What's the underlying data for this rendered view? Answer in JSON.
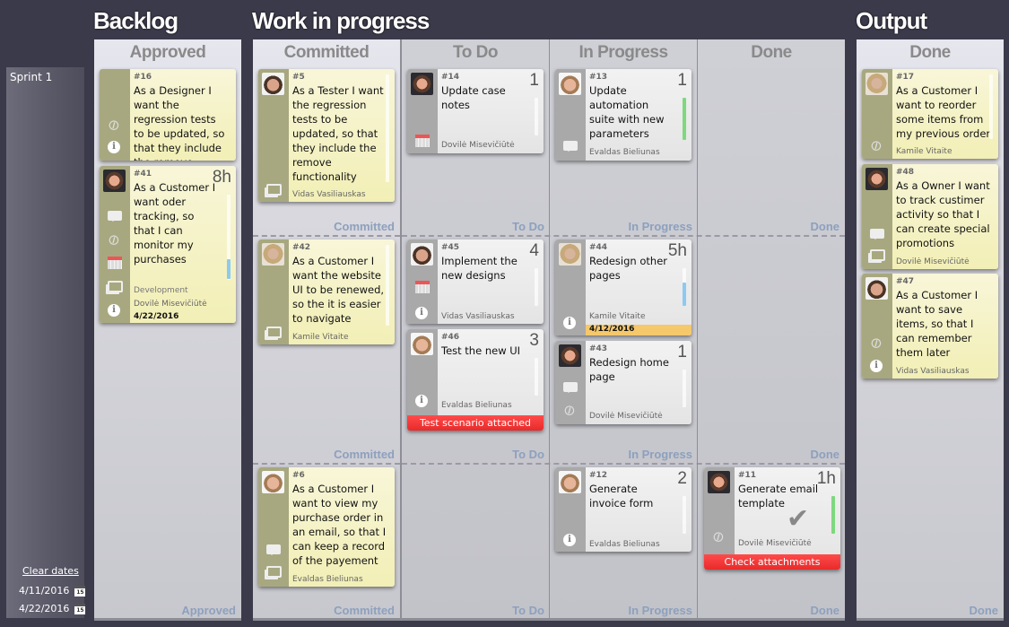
{
  "groups": {
    "backlog": "Backlog",
    "wip": "Work in progress",
    "output": "Output"
  },
  "sidebar": {
    "sprint": "Sprint 1",
    "clear_dates": "Clear dates",
    "dates": [
      "4/11/2016",
      "4/22/2016"
    ],
    "calendar_day": "15"
  },
  "columns": {
    "approved": "Approved",
    "committed": "Committed",
    "todo": "To Do",
    "inprogress": "In Progress",
    "done": "Done",
    "output_done": "Done"
  },
  "cards": {
    "c16": {
      "num": "#16",
      "title": "As a Designer I want the regression tests to be updated, so that they include the remove functionality"
    },
    "c41": {
      "num": "#41",
      "title": "As a Customer I want oder tracking, so that I can monitor my purchases",
      "estimate": "8h",
      "meta": "Development",
      "owner": "Dovilė Misevičiūtė",
      "due": "4/22/2016"
    },
    "c5": {
      "num": "#5",
      "title": "As a Tester I want the regression tests to be updated, so that they include the remove functionality",
      "owner": "Vidas Vasiliauskas"
    },
    "c42": {
      "num": "#42",
      "title": "As a Customer I want the website UI to be renewed, so the it is easier to navigate",
      "owner": "Kamile  Vitaite"
    },
    "c6": {
      "num": "#6",
      "title": "As a Customer I want to view my purchase order in an email, so that I can keep a record of the payement",
      "owner": "Evaldas Bieliunas"
    },
    "c14": {
      "num": "#14",
      "title": "Update case notes",
      "estimate": "1",
      "owner": "Dovilė Misevičiūtė"
    },
    "c45": {
      "num": "#45",
      "title": "Implement the new designs",
      "estimate": "4",
      "owner": "Vidas Vasiliauskas"
    },
    "c46": {
      "num": "#46",
      "title": "Test the new UI",
      "estimate": "3",
      "owner": "Evaldas Bieliunas",
      "banner": "Test scenario attached"
    },
    "c13": {
      "num": "#13",
      "title": "Update automation suite with new parameters",
      "estimate": "1",
      "owner": "Evaldas Bieliunas"
    },
    "c44": {
      "num": "#44",
      "title": "Redesign other pages",
      "estimate": "5h",
      "owner": "Kamile  Vitaite",
      "due": "4/12/2016"
    },
    "c43": {
      "num": "#43",
      "title": "Redesign home page",
      "estimate": "1",
      "owner": "Dovilė Misevičiūtė"
    },
    "c12": {
      "num": "#12",
      "title": "Generate invoice form",
      "estimate": "2",
      "owner": "Evaldas Bieliunas"
    },
    "c11": {
      "num": "#11",
      "title": "Generate email template",
      "estimate": "1h",
      "owner": "Dovilė Misevičiūtė",
      "banner": "Check attachments"
    },
    "c17": {
      "num": "#17",
      "title": "As a Customer I want to reorder some items from my previous order",
      "owner": "Kamile  Vitaite"
    },
    "c48": {
      "num": "#48",
      "title": "As a Owner I want to track custimer activity so that I can create special promotions",
      "owner": "Dovilė Misevičiūtė"
    },
    "c47": {
      "num": "#47",
      "title": "As a Customer I want to save items, so that I can remember them later",
      "owner": "Vidas Vasiliauskas"
    }
  },
  "colors": {
    "banner_red": "#f03a3a",
    "due_orange": "#f5c86c",
    "progress_green": "#7ed87e",
    "progress_blue": "#8ccaf0"
  }
}
